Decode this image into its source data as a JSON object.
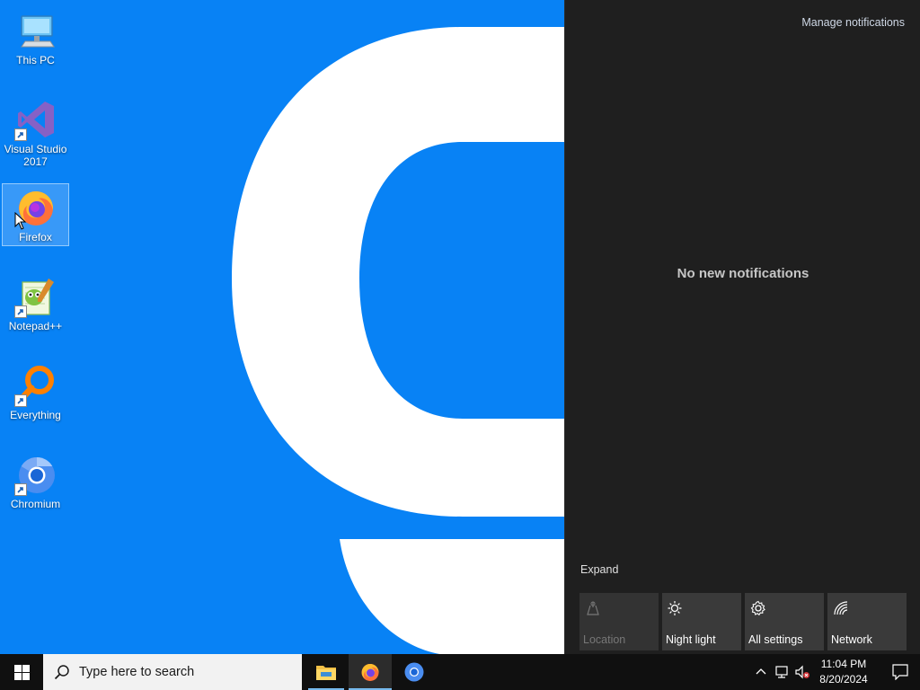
{
  "desktop": {
    "icons": [
      {
        "label": "This PC",
        "icon": "computer-icon"
      },
      {
        "label": "Visual Studio\n2017",
        "icon": "visual-studio-icon"
      },
      {
        "label": "Firefox",
        "icon": "firefox-icon"
      },
      {
        "label": "Notepad++",
        "icon": "notepadplusplus-icon"
      },
      {
        "label": "Everything",
        "icon": "everything-search-icon"
      },
      {
        "label": "Chromium",
        "icon": "chromium-icon"
      }
    ],
    "wallpaper_glyph": "9"
  },
  "action_center": {
    "manage_label": "Manage notifications",
    "empty_text": "No new notifications",
    "expand_label": "Expand",
    "quick_actions": [
      {
        "label": "Location",
        "icon": "location-icon",
        "enabled": false
      },
      {
        "label": "Night light",
        "icon": "brightness-icon",
        "enabled": true
      },
      {
        "label": "All settings",
        "icon": "gear-icon",
        "enabled": true
      },
      {
        "label": "Network",
        "icon": "network-icon",
        "enabled": true
      }
    ]
  },
  "taskbar": {
    "search_placeholder": "Type here to search",
    "pinned": [
      {
        "name": "File Explorer",
        "icon": "folder-icon"
      },
      {
        "name": "Firefox",
        "icon": "firefox-icon"
      },
      {
        "name": "Chromium",
        "icon": "chromium-icon"
      }
    ],
    "tray": {
      "time": "11:04 PM",
      "date": "8/20/2024"
    }
  },
  "colors": {
    "desktop_bg": "#0882f5",
    "panel_bg": "#1f1f1f",
    "taskbar_bg": "#101010",
    "accent": "#76b9ed"
  }
}
